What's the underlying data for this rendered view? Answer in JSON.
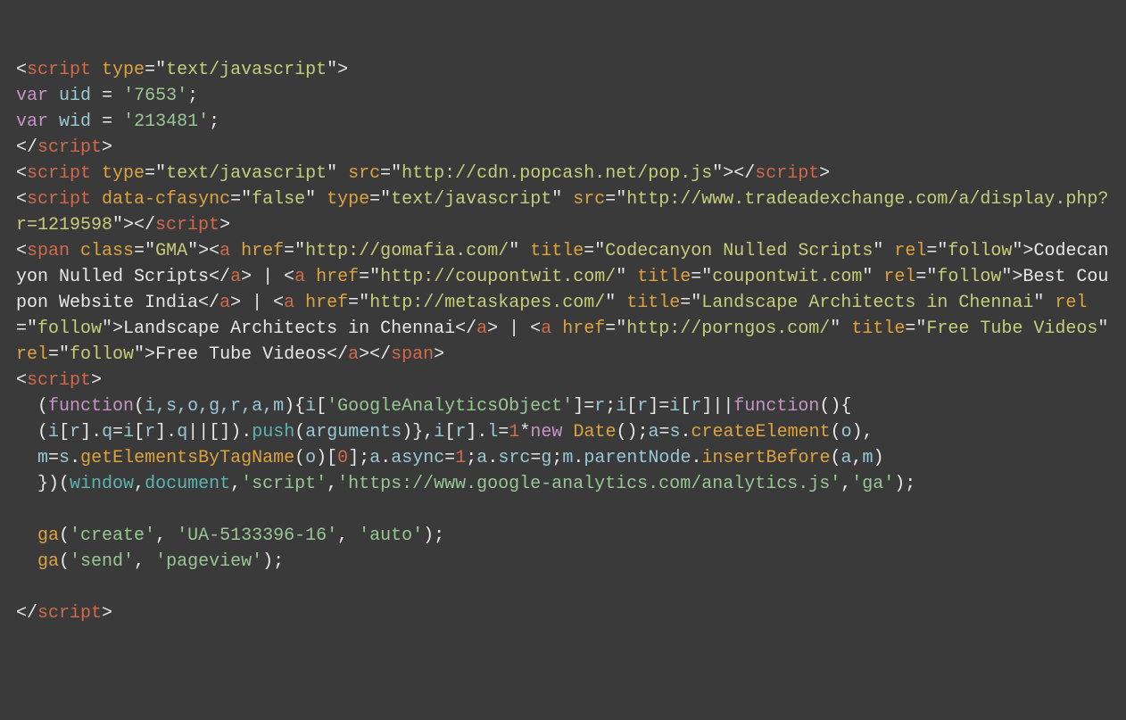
{
  "code": {
    "type_js": "text/javascript",
    "uid_var": "uid",
    "uid_val": "'7653'",
    "wid_var": "wid",
    "wid_val": "'213481'",
    "popcash_src": "http://cdn.popcash.net/pop.js",
    "cfasync_val": "false",
    "tradead_src": "http://www.tradeadexchange.com/a/display.php?r=1219598",
    "span_class": "GMA",
    "link1_href": "http://gomafia.com/",
    "link1_title": "Codecanyon Nulled Scripts",
    "rel_follow": "follow",
    "link1_text": "Codecanyon Nulled Scripts",
    "link2_href": "http://coupontwit.com/",
    "link2_title": "coupontwit.com",
    "link2_text": "Best Coupon Website India",
    "link3_href": "http://metaskapes.com/",
    "link3_title": "Landscape Architects in Chennai",
    "link3_text": "Landscape Architects in Chennai",
    "link4_href": "http://porngos.com/",
    "link4_title": "Free Tube Videos",
    "link4_text": "Free Tube Videos",
    "iife_params": "i,s,o,g,r,a,m",
    "gao": "'GoogleAnalyticsObject'",
    "arguments": "arguments",
    "date": "Date",
    "iife_window": "window",
    "iife_document": "document",
    "iife_script": "'script'",
    "iife_url": "'https://www.google-analytics.com/analytics.js'",
    "iife_ga": "'ga'",
    "ga_create": "'create'",
    "ga_ua": "'UA-5133396-16'",
    "ga_auto": "'auto'",
    "ga_send": "'send'",
    "ga_pageview": "'pageview'"
  }
}
